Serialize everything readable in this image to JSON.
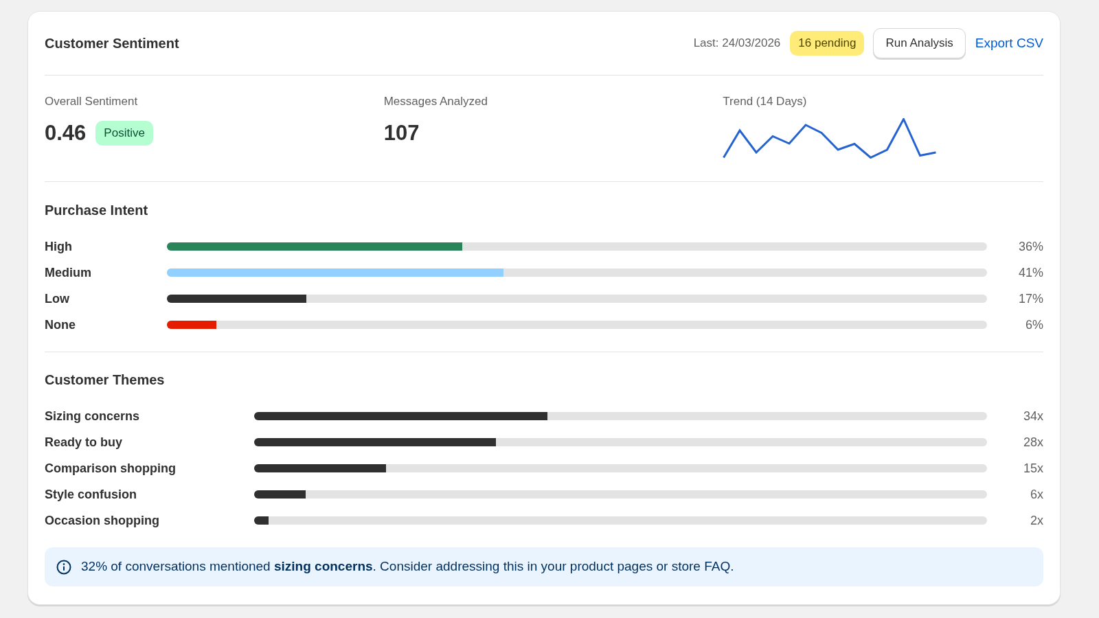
{
  "header": {
    "title": "Customer Sentiment",
    "last_run": "Last: 24/03/2026",
    "pending_badge": "16 pending",
    "run_button": "Run Analysis",
    "export_link": "Export CSV"
  },
  "stats": [
    {
      "kind": "score",
      "label": "Overall Sentiment",
      "value": "0.46",
      "badge": "Positive"
    },
    {
      "kind": "count",
      "label": "Messages Analyzed",
      "value": "107"
    },
    {
      "kind": "trend",
      "label": "Trend (14 Days)"
    }
  ],
  "purchase_intent": {
    "title": "Purchase Intent",
    "items": [
      {
        "label": "High",
        "level": 0.36,
        "color": "#29845a",
        "reading": "36%"
      },
      {
        "label": "Medium",
        "level": 0.41,
        "color": "#91d0ff",
        "reading": "41%"
      },
      {
        "label": "Low",
        "level": 0.17,
        "color": "#303030",
        "reading": "17%"
      },
      {
        "label": "None",
        "level": 0.06,
        "color": "#e51c00",
        "reading": "6%"
      }
    ]
  },
  "themes": {
    "title": "Customer Themes",
    "items": [
      {
        "label": "Sizing concerns",
        "level": 0.4,
        "reading": "34x"
      },
      {
        "label": "Ready to buy",
        "level": 0.33,
        "reading": "28x"
      },
      {
        "label": "Comparison shopping",
        "level": 0.18,
        "reading": "15x"
      },
      {
        "label": "Style confusion",
        "level": 0.07,
        "reading": "6x"
      },
      {
        "label": "Occasion shopping",
        "level": 0.02,
        "reading": "2x"
      }
    ]
  },
  "insight": {
    "text": "32% of conversations mentioned **sizing concerns**. Consider addressing this in your product pages or store FAQ."
  }
}
